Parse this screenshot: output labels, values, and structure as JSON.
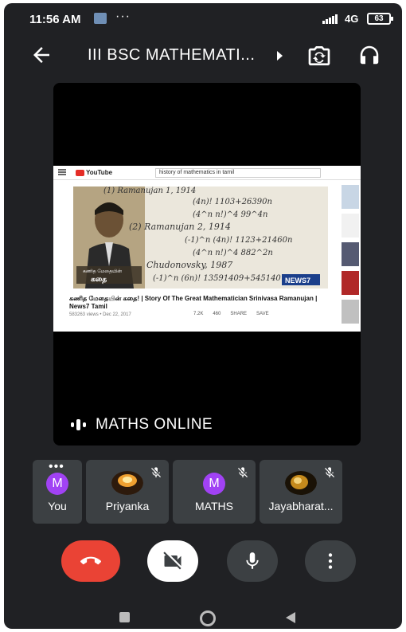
{
  "status_bar": {
    "time": "11:56 AM",
    "overflow": "···",
    "network": "4G",
    "battery": "63"
  },
  "app_bar": {
    "meeting_title": "III BSC MATHEMATI..."
  },
  "main_tile": {
    "presenter_label": "MATHS ONLINE",
    "shared_screen": {
      "site": "YouTube",
      "search_query": "history of mathematics in tamil",
      "video_title": "கணித மேதையின் கதை! | Story Of The Great Mathematician Srinivasa Ramanujan | News7 Tamil",
      "video_meta": "583263 views • Dec 22, 2017",
      "likes": "7.2K",
      "dislikes": "460",
      "share": "SHARE",
      "save": "SAVE",
      "thumb_caption": "கதை",
      "thumb_brand": "NEWS7",
      "formula_lines": [
        "(1) Ramanujan 1, 1914",
        "(4n)! 1103+26390n",
        "(4^n n!)^4 99^4n",
        "(2) Ramanujan 2, 1914",
        "(-1)^n (4n)! 1123+21460n",
        "(4^n n!)^4 882^2n",
        "Chudonovsky, 1987",
        "(-1)^n (6n)! 13591409+545140"
      ]
    }
  },
  "participants": [
    {
      "name": "You",
      "initial": "M",
      "muted": false,
      "has_photo": false
    },
    {
      "name": "Priyanka",
      "initial": "",
      "muted": true,
      "has_photo": true
    },
    {
      "name": "MATHS",
      "initial": "M",
      "muted": true,
      "has_photo": false
    },
    {
      "name": "Jayabharat...",
      "initial": "",
      "muted": true,
      "has_photo": true
    }
  ],
  "icons": {
    "back": "arrow-left-icon",
    "switch_camera": "switch-camera-icon",
    "audio_output": "headphones-icon",
    "end_call": "phone-hangup-icon",
    "camera": "video-off-icon",
    "microphone": "mic-icon",
    "more": "more-vert-icon"
  },
  "colors": {
    "background": "#202124",
    "tile": "#3c4043",
    "end_call": "#ea4335",
    "avatar": "#a142f4"
  }
}
